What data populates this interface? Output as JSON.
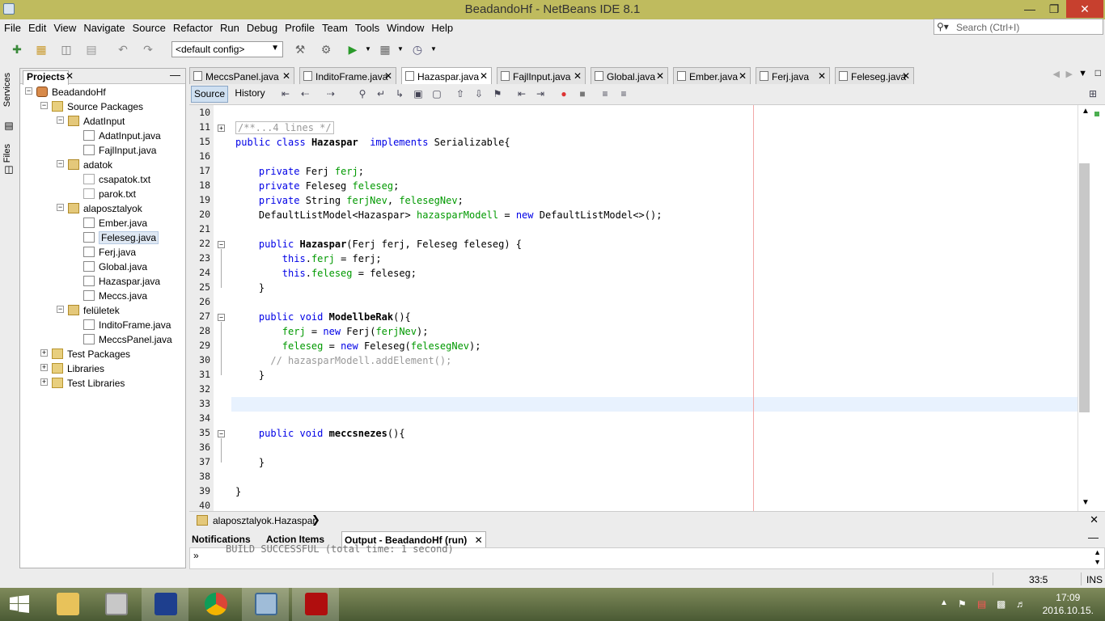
{
  "window": {
    "title": "BeadandoHf - NetBeans IDE 8.1",
    "minimize": "—",
    "restore": "❐",
    "close": "✕"
  },
  "menu": [
    "File",
    "Edit",
    "View",
    "Navigate",
    "Source",
    "Refactor",
    "Run",
    "Debug",
    "Profile",
    "Team",
    "Tools",
    "Window",
    "Help"
  ],
  "search": {
    "placeholder": "Search (Ctrl+I)"
  },
  "toolbar": {
    "config": "<default config>"
  },
  "side_tabs": [
    "Services",
    "Files"
  ],
  "projects": {
    "title": "Projects",
    "tree": [
      {
        "label": "BeadandoHf",
        "kind": "project",
        "depth": 0,
        "exp": "−"
      },
      {
        "label": "Source Packages",
        "kind": "folder",
        "depth": 1,
        "exp": "−"
      },
      {
        "label": "AdatInput",
        "kind": "package",
        "depth": 2,
        "exp": "−"
      },
      {
        "label": "AdatInput.java",
        "kind": "java",
        "depth": 3
      },
      {
        "label": "FajlInput.java",
        "kind": "java",
        "depth": 3
      },
      {
        "label": "adatok",
        "kind": "package",
        "depth": 2,
        "exp": "−"
      },
      {
        "label": "csapatok.txt",
        "kind": "text",
        "depth": 3
      },
      {
        "label": "parok.txt",
        "kind": "text",
        "depth": 3
      },
      {
        "label": "alaposztalyok",
        "kind": "package",
        "depth": 2,
        "exp": "−"
      },
      {
        "label": "Ember.java",
        "kind": "java",
        "depth": 3
      },
      {
        "label": "Feleseg.java",
        "kind": "java",
        "depth": 3,
        "selected": true
      },
      {
        "label": "Ferj.java",
        "kind": "java",
        "depth": 3
      },
      {
        "label": "Global.java",
        "kind": "java",
        "depth": 3
      },
      {
        "label": "Hazaspar.java",
        "kind": "java",
        "depth": 3
      },
      {
        "label": "Meccs.java",
        "kind": "java",
        "depth": 3
      },
      {
        "label": "felületek",
        "kind": "package",
        "depth": 2,
        "exp": "−"
      },
      {
        "label": "InditoFrame.java",
        "kind": "java",
        "depth": 3
      },
      {
        "label": "MeccsPanel.java",
        "kind": "java",
        "depth": 3
      },
      {
        "label": "Test Packages",
        "kind": "folder",
        "depth": 1,
        "exp": "+"
      },
      {
        "label": "Libraries",
        "kind": "folder",
        "depth": 1,
        "exp": "+"
      },
      {
        "label": "Test Libraries",
        "kind": "folder",
        "depth": 1,
        "exp": "+"
      }
    ]
  },
  "editor_tabs": [
    {
      "label": "MeccsPanel.java"
    },
    {
      "label": "InditoFrame.java"
    },
    {
      "label": "Hazaspar.java",
      "active": true
    },
    {
      "label": "FajlInput.java"
    },
    {
      "label": "Global.java"
    },
    {
      "label": "Ember.java"
    },
    {
      "label": "Ferj.java"
    },
    {
      "label": "Feleseg.java"
    }
  ],
  "editor_toolbar": {
    "source": "Source",
    "history": "History"
  },
  "code": [
    {
      "n": "10",
      "html": ""
    },
    {
      "n": "11",
      "html": "<span class='cmt' style='border:1px solid #bbb;padding:0 2px'>/**...4 lines */</span>"
    },
    {
      "n": "15",
      "html": "<span class='kw'>public class</span> <b>Hazaspar</b>  <span class='kw'>implements</span> Serializable{"
    },
    {
      "n": "16",
      "html": ""
    },
    {
      "n": "17",
      "html": "    <span class='kw'>private</span> Ferj <span class='fld'>ferj</span>;"
    },
    {
      "n": "18",
      "html": "    <span class='kw'>private</span> Feleseg <span class='fld'>feleseg</span>;"
    },
    {
      "n": "19",
      "html": "    <span class='kw'>private</span> String <span class='fld'>ferjNev</span>, <span class='fld'>felesegNev</span>;"
    },
    {
      "n": "20",
      "html": "    DefaultListModel&lt;Hazaspar&gt; <span class='fld'>hazasparModell</span> = <span class='kw'>new</span> DefaultListModel&lt;&gt;();"
    },
    {
      "n": "21",
      "html": ""
    },
    {
      "n": "22",
      "html": "    <span class='kw'>public</span> <b>Hazaspar</b>(Ferj ferj, Feleseg feleseg) {"
    },
    {
      "n": "23",
      "html": "        <span class='kw'>this</span>.<span class='fld'>ferj</span> = ferj;"
    },
    {
      "n": "24",
      "html": "        <span class='kw'>this</span>.<span class='fld'>feleseg</span> = feleseg;"
    },
    {
      "n": "25",
      "html": "    }"
    },
    {
      "n": "26",
      "html": ""
    },
    {
      "n": "27",
      "html": "    <span class='kw'>public void</span> <b>ModellbeRak</b>(){"
    },
    {
      "n": "28",
      "html": "        <span class='fld'>ferj</span> = <span class='kw'>new</span> Ferj(<span class='fld'>ferjNev</span>);"
    },
    {
      "n": "29",
      "html": "        <span class='fld'>feleseg</span> = <span class='kw'>new</span> Feleseg(<span class='fld'>felesegNev</span>);"
    },
    {
      "n": "30",
      "html": "      <span class='cmt'>// hazasparModell.addElement();</span>"
    },
    {
      "n": "31",
      "html": "    }"
    },
    {
      "n": "32",
      "html": ""
    },
    {
      "n": "33",
      "html": ""
    },
    {
      "n": "34",
      "html": ""
    },
    {
      "n": "35",
      "html": "    <span class='kw'>public void</span> <b>meccsnezes</b>(){"
    },
    {
      "n": "36",
      "html": ""
    },
    {
      "n": "37",
      "html": "    }"
    },
    {
      "n": "38",
      "html": ""
    },
    {
      "n": "39",
      "html": "}"
    },
    {
      "n": "40",
      "html": ""
    }
  ],
  "breadcrumb": {
    "path": "alaposztalyok.Hazaspar"
  },
  "bottom_tabs": [
    {
      "label": "Notifications"
    },
    {
      "label": "Action Items"
    },
    {
      "label": "Output - BeadandoHf (run)",
      "active": true
    }
  ],
  "output": {
    "text": "BUILD SUCCESSFUL (total time: 1 second)"
  },
  "status": {
    "position": "33:5",
    "mode": "INS"
  },
  "taskbar": {
    "time": "17:09",
    "date": "2016.10.15."
  },
  "colors": {
    "titlebar": "#bfbb5e",
    "keyword": "#0000e6",
    "field": "#009900",
    "comment": "#999999"
  }
}
